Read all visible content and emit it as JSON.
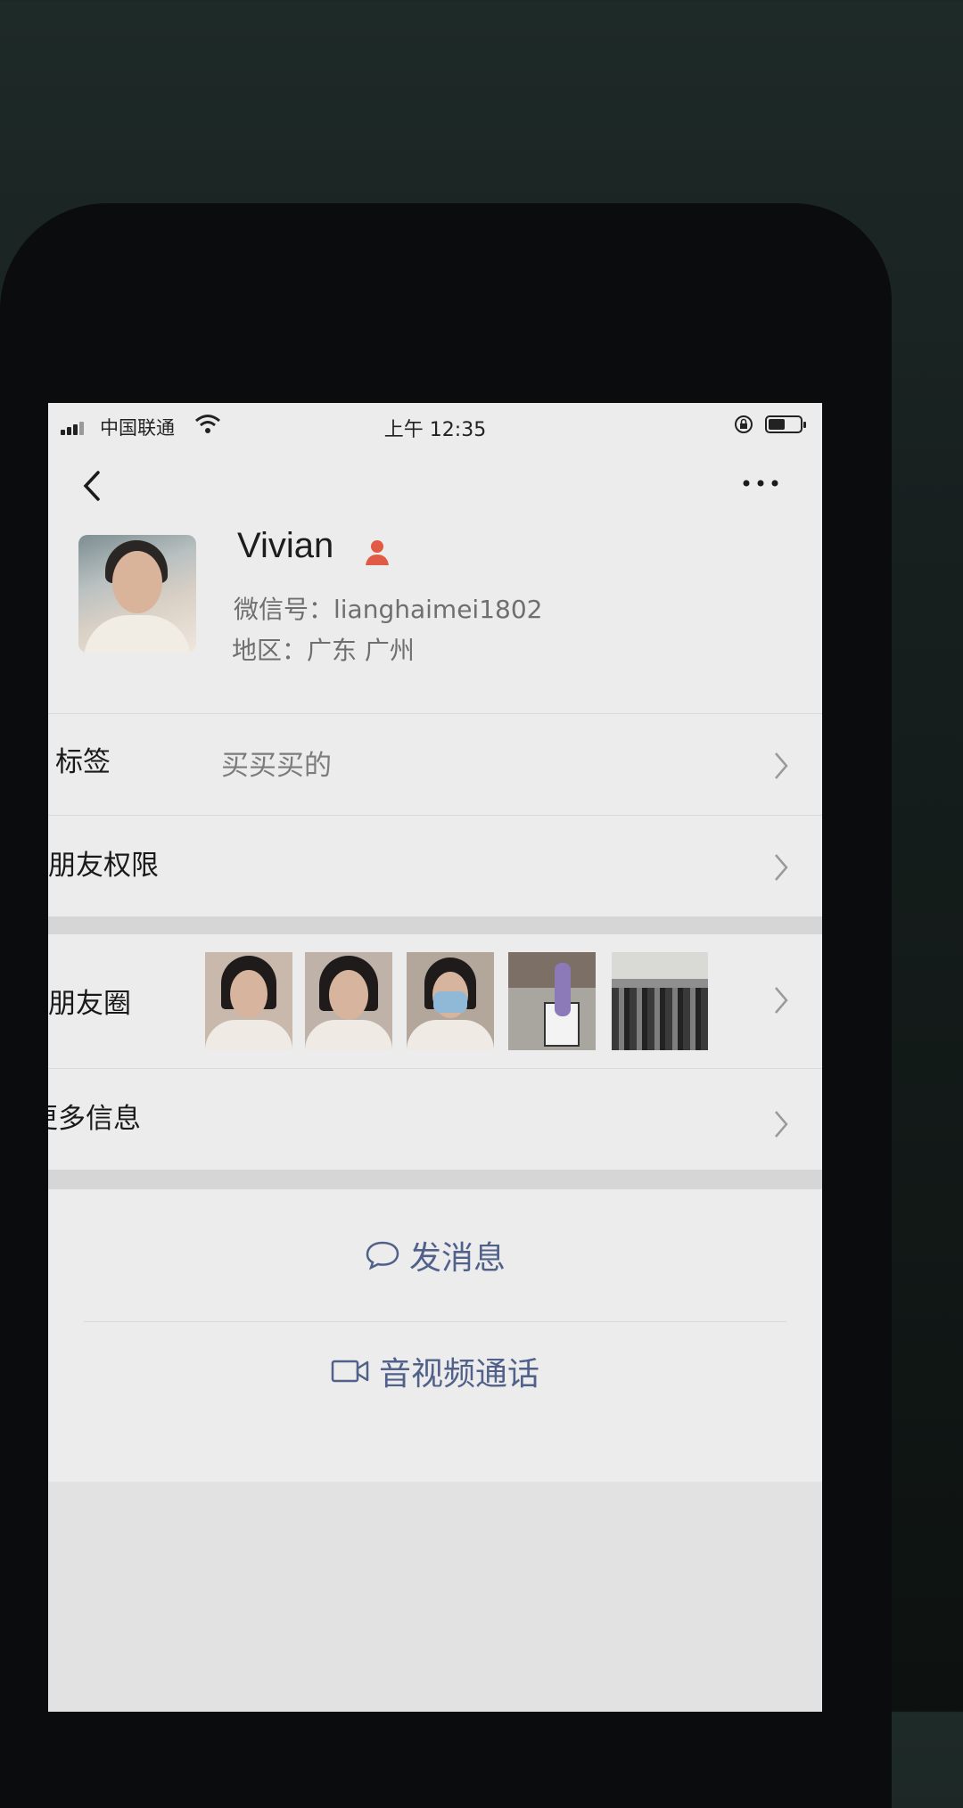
{
  "status_bar": {
    "carrier": "中国联通",
    "time": "上午 12:35"
  },
  "profile": {
    "name": "Vivian",
    "wechat_id": "微信号：lianghaimei1802",
    "region": "地区：广东 广州"
  },
  "rows": {
    "tags": {
      "label": "标签",
      "value": "买买买的"
    },
    "permissions": {
      "label": "朋友权限"
    },
    "moments": {
      "label": "朋友圈"
    },
    "more_info": {
      "label": "更多信息"
    }
  },
  "actions": {
    "send_message": "发消息",
    "video_call": "音视频通话"
  },
  "icons": [
    "back-icon",
    "more-icon",
    "person-icon",
    "chevron-right-icon",
    "chat-bubble-icon",
    "video-camera-icon",
    "wifi-icon",
    "battery-icon"
  ],
  "colors": {
    "accent": "#51618a",
    "person_icon": "#e05a45"
  }
}
